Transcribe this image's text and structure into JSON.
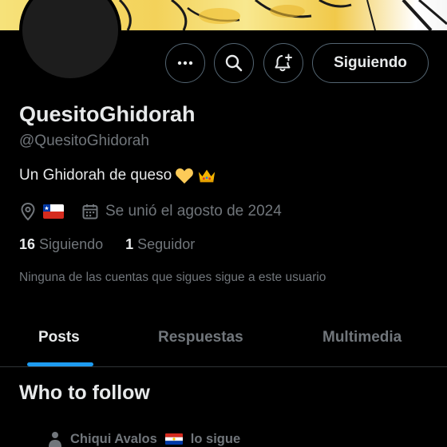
{
  "profile": {
    "display_name": "QuesitoGhidorah",
    "handle": "@QuesitoGhidorah",
    "bio": "Un Ghidorah de queso",
    "bio_emojis": [
      "yellow-heart",
      "crown"
    ],
    "location_flag": "chile-flag",
    "joined": "Se unió el agosto de 2024",
    "following_count": "16",
    "following_label": "Siguiendo",
    "followers_count": "1",
    "followers_label": "Seguidor",
    "mutual_text": "Ninguna de las cuentas que sigues sigue a este usuario"
  },
  "actions": {
    "more_icon": "more-icon",
    "search_icon": "search-icon",
    "notify_icon": "bell-add-icon",
    "follow_label": "Siguiendo"
  },
  "tabs": [
    {
      "label": "Posts",
      "active": true
    },
    {
      "label": "Respuestas",
      "active": false
    },
    {
      "label": "Multimedia",
      "active": false
    }
  ],
  "who_to_follow": {
    "title": "Who to follow",
    "suggestion": {
      "name": "Chiqui Avalos",
      "flag": "paraguay-flag",
      "suffix": "lo sigue"
    }
  },
  "colors": {
    "background": "#000000",
    "accent": "#1d9bf0",
    "text_primary": "#e7e9ea",
    "text_secondary": "#71767b",
    "border": "#2f3336"
  }
}
